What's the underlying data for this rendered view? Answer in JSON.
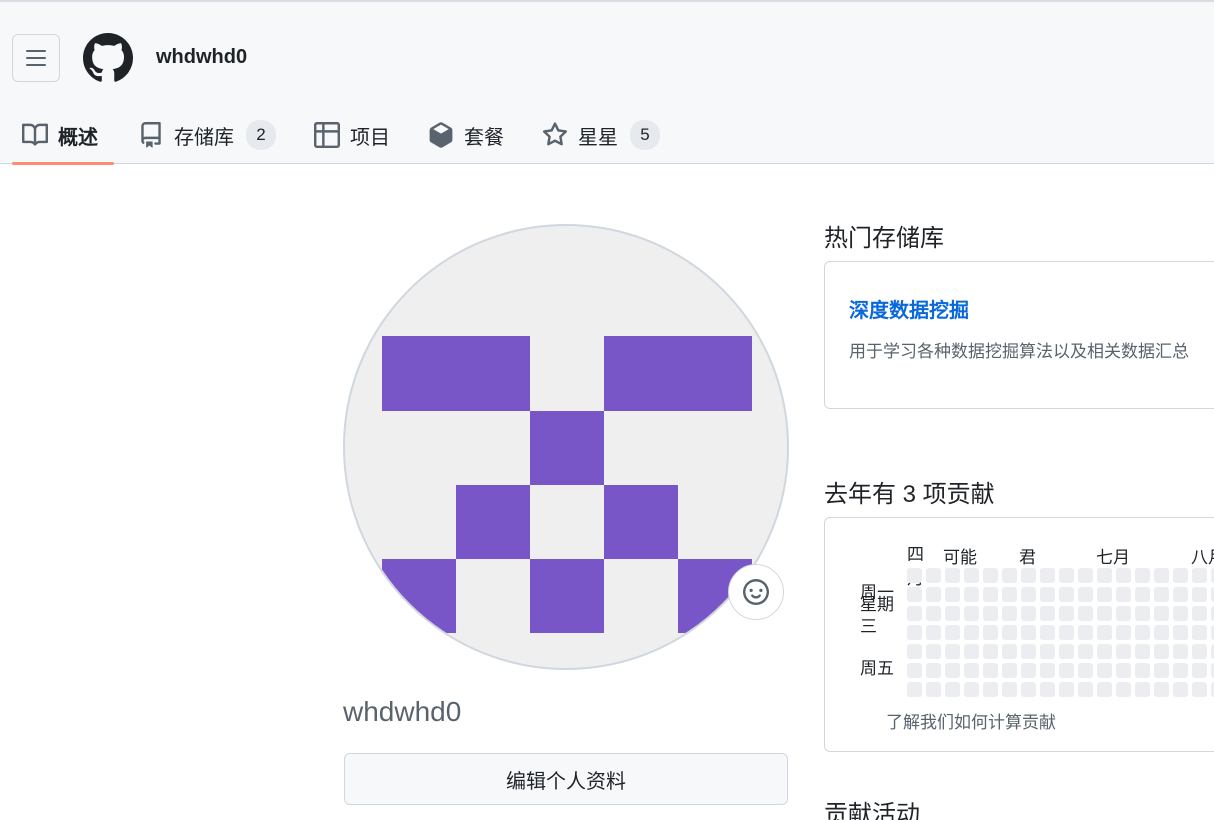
{
  "header": {
    "menu_icon": "hamburger-icon",
    "logo_icon": "github-mark-icon",
    "username": "whdwhd0"
  },
  "tabs": [
    {
      "label": "概述",
      "icon": "book-icon",
      "active": true
    },
    {
      "label": "存储库",
      "icon": "repo-icon",
      "count": "2"
    },
    {
      "label": "项目",
      "icon": "table-icon"
    },
    {
      "label": "套餐",
      "icon": "package-icon"
    },
    {
      "label": "星星",
      "icon": "star-icon",
      "count": "5"
    }
  ],
  "profile": {
    "avatar_color": "#7856c8",
    "status_icon": "smiley-icon",
    "login": "whdwhd0",
    "edit_button": "编辑个人资料"
  },
  "popular": {
    "title": "热门存储库",
    "repo": {
      "name": "深度数据挖掘",
      "description": "用于学习各种数据挖掘算法以及相关数据汇总"
    }
  },
  "contributions": {
    "title": "去年有 3 项贡献",
    "months": [
      "四月",
      "可能",
      "君",
      "七月",
      "八月"
    ],
    "days": {
      "mon": "周一",
      "wed": "星期三",
      "fri": "周五"
    },
    "empty_cell_color": "#ebedf0",
    "learn_link": "了解我们如何计算贡献"
  },
  "activity": {
    "title": "贡献活动"
  },
  "colors": {
    "accent_underline": "#fd8c73",
    "link": "#0969da"
  }
}
